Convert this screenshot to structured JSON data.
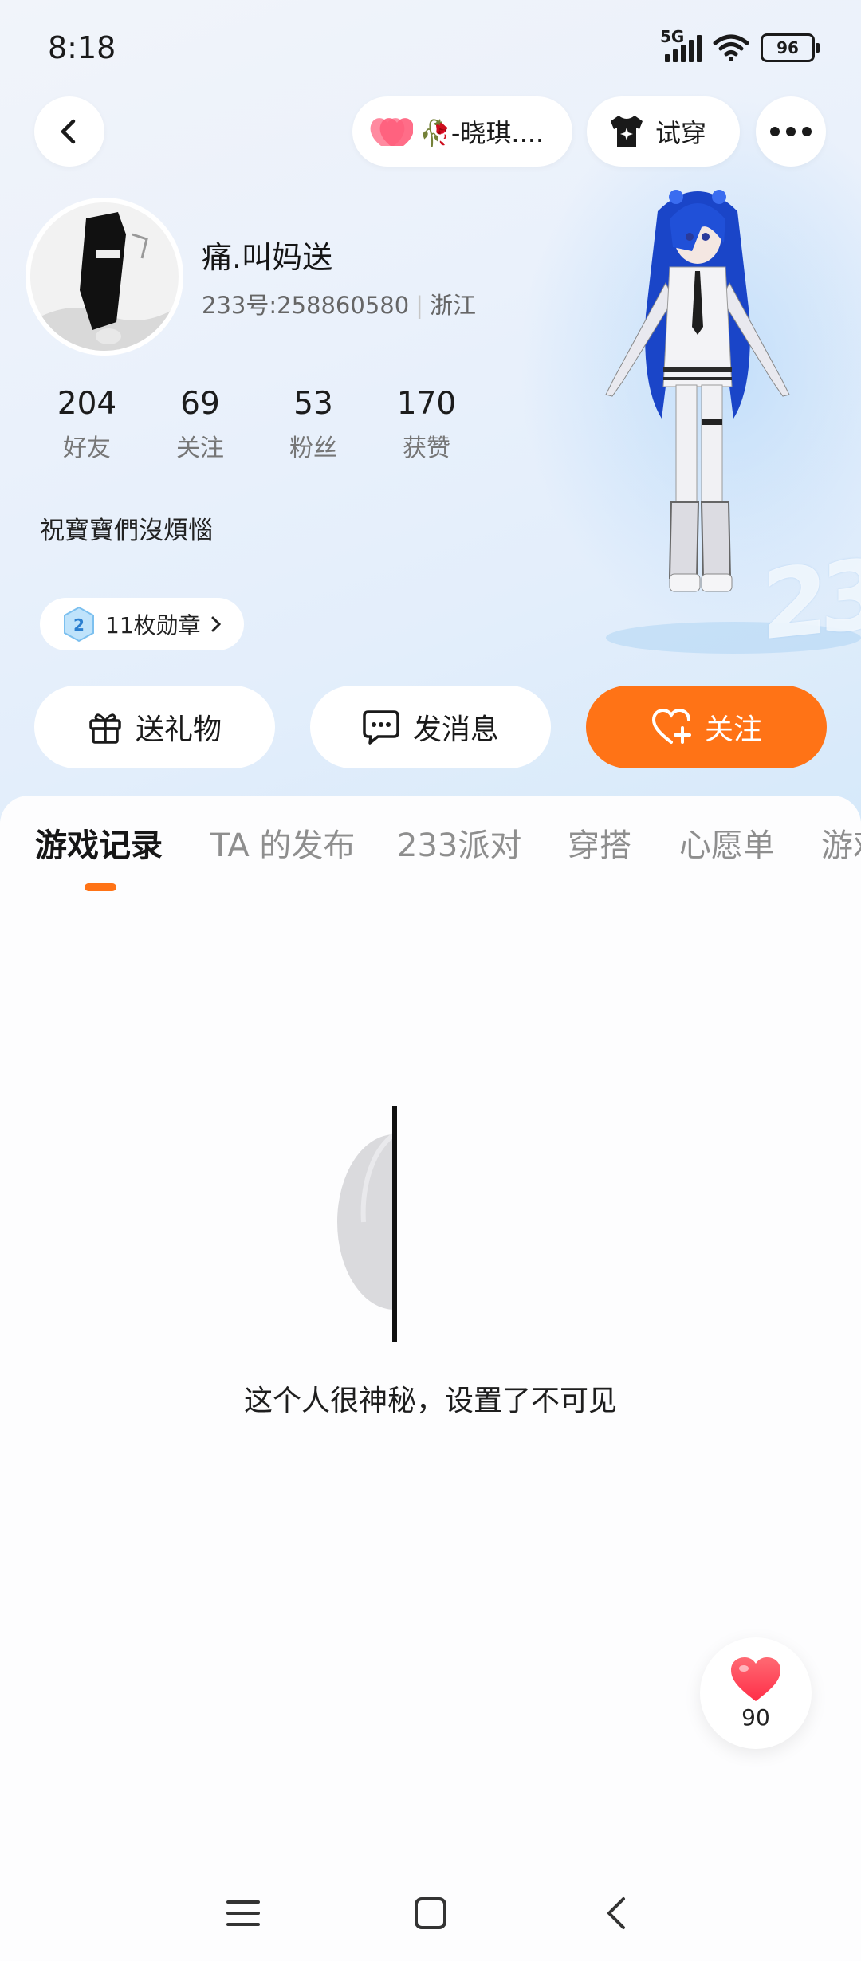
{
  "status_bar": {
    "time": "8:18",
    "network": "5G",
    "battery": "96"
  },
  "header": {
    "partner_name": "🥀-晓琪....",
    "tryon_label": "试穿"
  },
  "profile": {
    "nickname": "痛.叫妈送",
    "uid": "233号:258860580",
    "location": "浙江",
    "bio": "祝寶寶們沒煩惱",
    "stats": [
      {
        "value": "204",
        "label": "好友"
      },
      {
        "value": "69",
        "label": "关注"
      },
      {
        "value": "53",
        "label": "粉丝"
      },
      {
        "value": "170",
        "label": "获赞"
      }
    ],
    "medal_label": "11枚勋章"
  },
  "actions": {
    "gift": "送礼物",
    "message": "发消息",
    "follow": "关注"
  },
  "tabs": [
    "游戏记录",
    "TA 的发布",
    "233派对",
    "穿搭",
    "心愿单",
    "游戏"
  ],
  "active_tab": "游戏记录",
  "empty_message": "这个人很神秘，设置了不可见",
  "like_count": "90",
  "colors": {
    "accent": "#ff7316",
    "like": "#ff4b5c"
  },
  "icons": [
    "back-icon",
    "heart-icon",
    "tshirt-icon",
    "more-icon",
    "gift-icon",
    "message-icon",
    "heart-plus-icon",
    "menu-icon",
    "home-icon",
    "nav-back-icon"
  ]
}
